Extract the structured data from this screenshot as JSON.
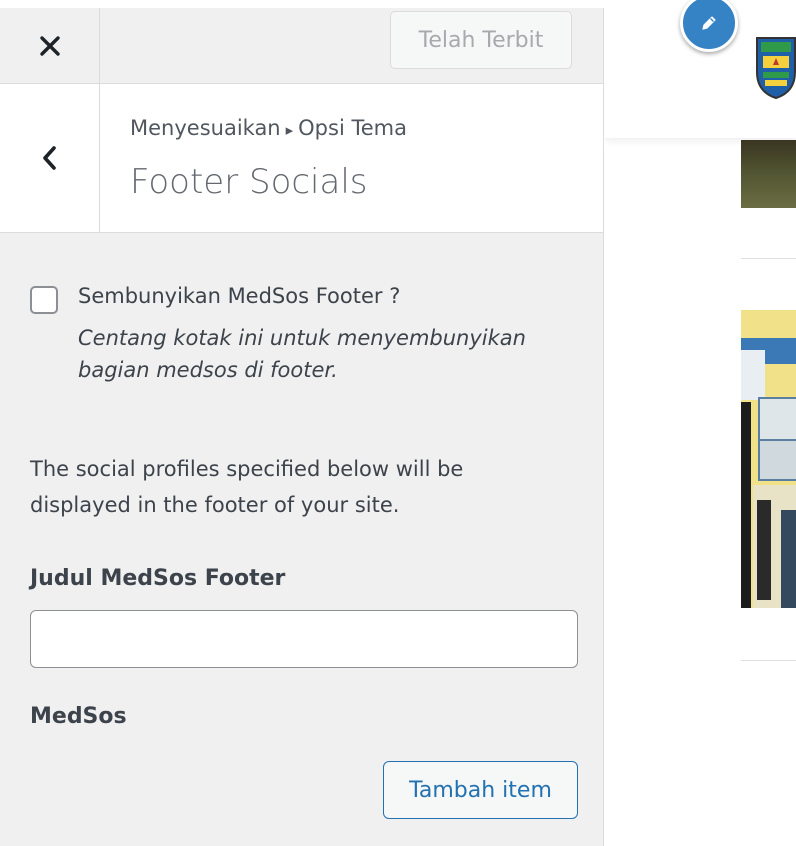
{
  "topbar": {
    "close_icon": "close-icon",
    "publish_label": "Telah Terbit"
  },
  "section": {
    "back_icon": "chevron-left-icon",
    "breadcrumb": {
      "parent": "Menyesuaikan",
      "separator": "▸",
      "current": "Opsi Tema"
    },
    "title": "Footer Socials"
  },
  "controls": {
    "hide_footer": {
      "label": "Sembunyikan MedSos Footer ?",
      "description": "Centang kotak ini untuk menyembunyikan bagian medsos di footer.",
      "checked": false
    },
    "intro": "The social profiles specified below will be displayed in the footer of your site.",
    "footer_title": {
      "label": "Judul MedSos Footer",
      "value": ""
    },
    "medsos": {
      "label": "MedSos",
      "add_button": "Tambah item"
    }
  },
  "preview": {
    "edit_icon": "pencil-icon",
    "logo": "crest-logo"
  },
  "colors": {
    "accent": "#2271b1",
    "shortcut": "#3582c4",
    "sidebar_bg": "#f0f0f1"
  }
}
